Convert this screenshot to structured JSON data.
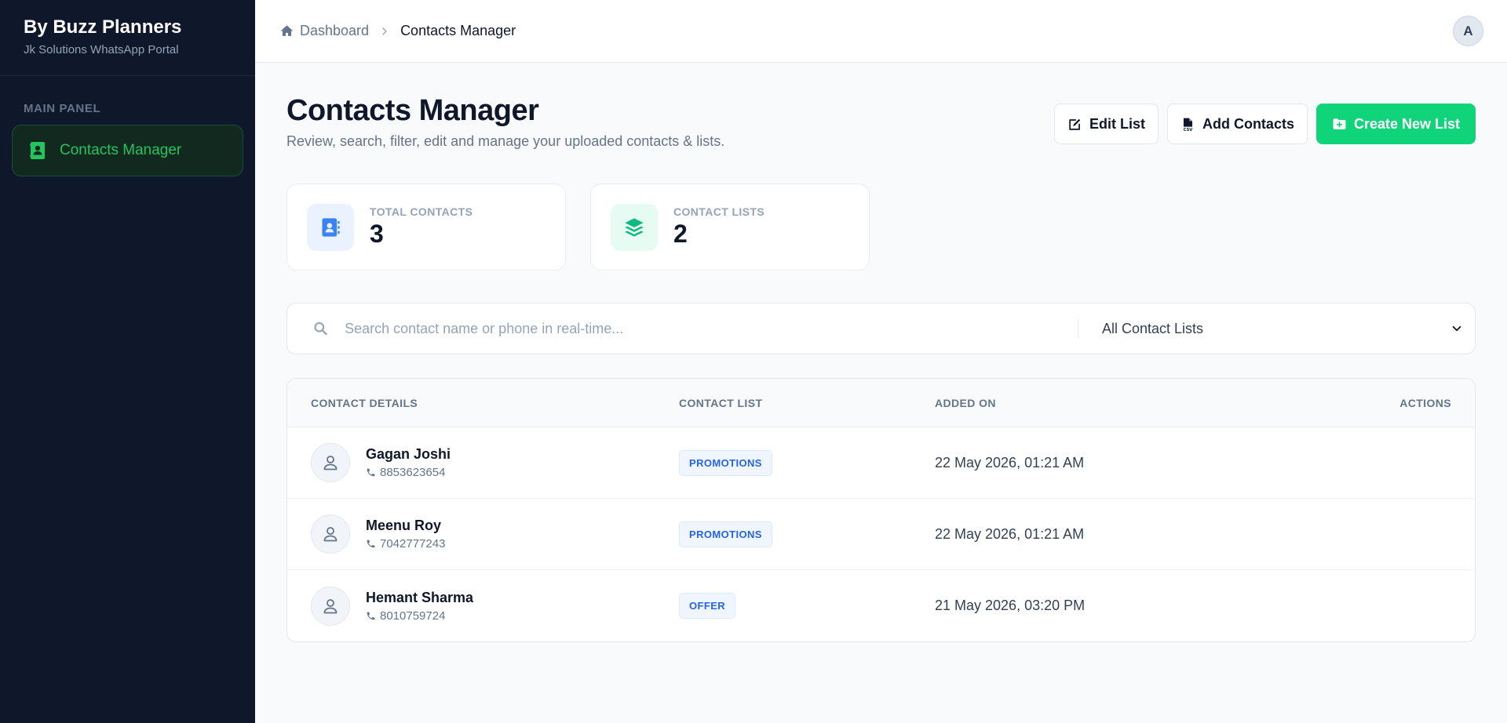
{
  "brand": {
    "title": "By Buzz Planners",
    "subtitle": "Jk Solutions WhatsApp Portal"
  },
  "sidebar": {
    "section_label": "MAIN PANEL",
    "items": [
      {
        "label": "Contacts Manager",
        "icon": "contact-book-icon",
        "active": true
      }
    ]
  },
  "topbar": {
    "breadcrumb": {
      "home_label": "Dashboard",
      "current_label": "Contacts Manager"
    },
    "avatar_initial": "A"
  },
  "page": {
    "title": "Contacts Manager",
    "subtitle": "Review, search, filter, edit and manage your uploaded contacts & lists."
  },
  "actions": {
    "edit_label": "Edit List",
    "add_label": "Add Contacts",
    "create_label": "Create New List"
  },
  "stats": [
    {
      "label": "TOTAL CONTACTS",
      "value": "3",
      "icon": "address-book-icon"
    },
    {
      "label": "CONTACT LISTS",
      "value": "2",
      "icon": "layers-icon"
    }
  ],
  "filters": {
    "search_placeholder": "Search contact name or phone in real-time...",
    "search_value": "",
    "list_select_value": "All Contact Lists"
  },
  "table": {
    "columns": [
      "CONTACT DETAILS",
      "CONTACT LIST",
      "ADDED ON",
      "ACTIONS"
    ],
    "rows": [
      {
        "name": "Gagan Joshi",
        "phone": "8853623654",
        "list": "PROMOTIONS",
        "added": "22 May 2026, 01:21 AM"
      },
      {
        "name": "Meenu Roy",
        "phone": "7042777243",
        "list": "PROMOTIONS",
        "added": "22 May 2026, 01:21 AM"
      },
      {
        "name": "Hemant Sharma",
        "phone": "8010759724",
        "list": "OFFER",
        "added": "21 May 2026, 03:20 PM"
      }
    ]
  },
  "colors": {
    "sidebar_bg": "#0f172a",
    "accent_green": "#10d47a",
    "badge_blue": "#2563eb"
  }
}
